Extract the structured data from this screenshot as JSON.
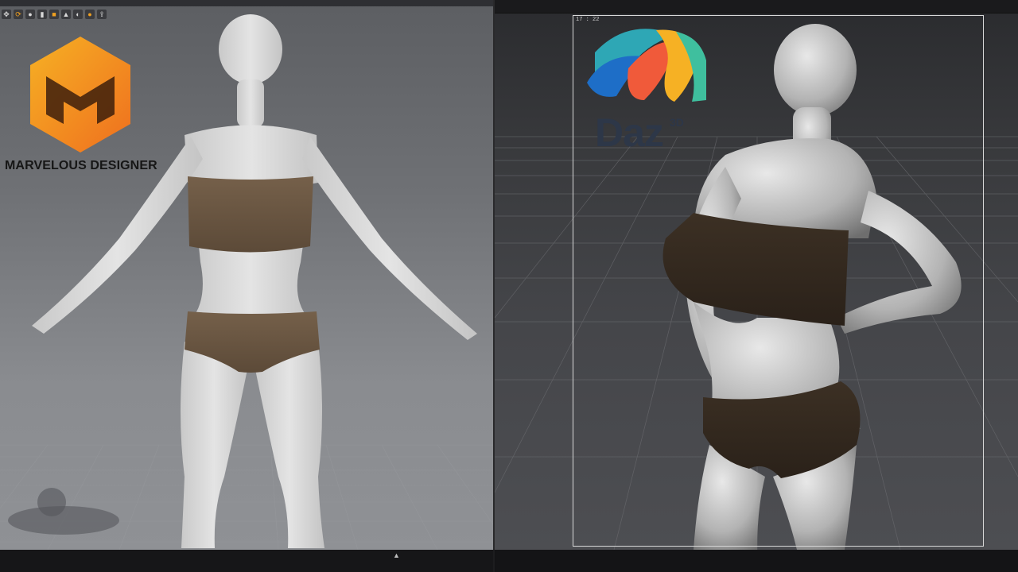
{
  "md": {
    "logo_text": "MARVELOUS DESIGNER",
    "toolbar_icons": [
      "move-icon",
      "rotate-icon",
      "user-icon",
      "camera-icon",
      "folder-icon",
      "render-icon",
      "avatar-icon",
      "sphere-icon",
      "export-icon"
    ],
    "toolbar_glyphs": [
      "✥",
      "⟳",
      "●",
      "▮",
      "■",
      "▲",
      "◐",
      "●",
      "⇪"
    ],
    "collapse_glyph": "▲"
  },
  "daz": {
    "logo_text": "Daz",
    "logo_superscript": "3D",
    "frame_label": "17 : 22"
  },
  "colors": {
    "garment": "#6a5641",
    "garment_dark": "#3a2e22",
    "skin_md": "#d9d9d9",
    "skin_daz": "#bdbdbd",
    "md_logo_orange": "#f39a1e"
  }
}
